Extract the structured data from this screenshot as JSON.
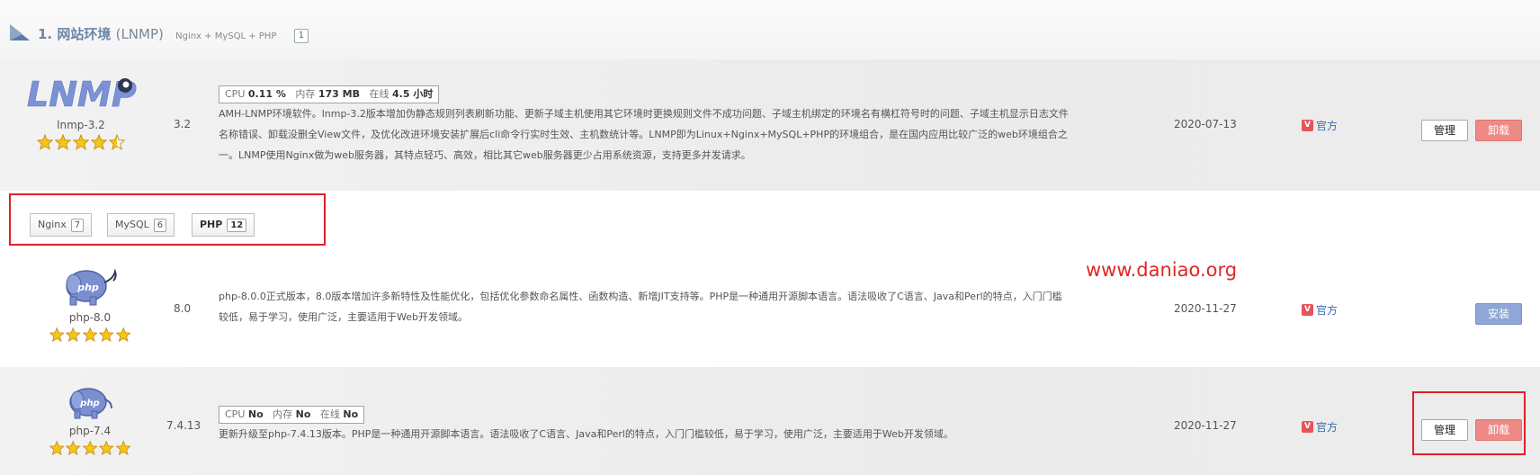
{
  "section": {
    "title": "1. 网站环境",
    "subtitle": "(LNMP)",
    "small": "Nginx + MySQL + PHP",
    "count": "1"
  },
  "lnmp": {
    "logo_text": "LNMP",
    "name": "lnmp-3.2",
    "stars": 4.5,
    "version": "3.2",
    "usage": {
      "cpu_label": "CPU",
      "cpu_value": "0.11 %",
      "mem_label": "内存",
      "mem_value": "173 MB",
      "online_label": "在线",
      "online_value": "4.5 小时"
    },
    "desc_lines": [
      "AMH-LNMP环境软件。lnmp-3.2版本增加伪静态规则列表刷新功能、更新子域主机使用其它环境时更换规则文件不成功问题、子域主机绑定的环境名有横杠符号时的问题、子域主机显示日志文件",
      "名称错误、卸载没删全View文件，及优化改进环境安装扩展后cli命令行实时生效、主机数统计等。LNMP即为Linux+Nginx+MySQL+PHP的环境组合，是在国内应用比较广泛的web环境组合之",
      "一。LNMP使用Nginx做为web服务器，其特点轻巧、高效，相比其它web服务器更少占用系统资源，支持更多并发请求。"
    ],
    "date": "2020-07-13",
    "official": "官方",
    "manage_label": "管理",
    "uninstall_label": "卸载"
  },
  "tabs": [
    {
      "label": "Nginx",
      "count": "7"
    },
    {
      "label": "MySQL",
      "count": "6"
    },
    {
      "label": "PHP",
      "count": "12"
    }
  ],
  "watermark": "www.daniao.org",
  "php80": {
    "name": "php-8.0",
    "stars": 5,
    "version": "8.0",
    "desc_lines": [
      "php-8.0.0正式版本，8.0版本增加许多新特性及性能优化，包括优化参数命名属性、函数构造、新增JIT支持等。PHP是一种通用开源脚本语言。语法吸收了C语言、Java和Perl的特点，入门门槛",
      "较低，易于学习，使用广泛，主要适用于Web开发领域。"
    ],
    "date": "2020-11-27",
    "official": "官方",
    "install_label": "安装"
  },
  "php74": {
    "name": "php-7.4",
    "stars": 5,
    "version": "7.4.13",
    "usage": {
      "cpu_label": "CPU",
      "cpu_value": "No",
      "mem_label": "内存",
      "mem_value": "No",
      "online_label": "在线",
      "online_value": "No"
    },
    "desc_lines": [
      "更新升级至php-7.4.13版本。PHP是一种通用开源脚本语言。语法吸收了C语言、Java和Perl的特点，入门门槛较低，易于学习，使用广泛，主要适用于Web开发领域。"
    ],
    "date": "2020-11-27",
    "official": "官方",
    "manage_label": "管理",
    "uninstall_label": "卸载"
  },
  "colors": {
    "accent": "#6f85a8",
    "uninstall": "#ee8a86",
    "install": "#8fa7d6",
    "highlight": "#e0202a",
    "official": "#3a6aa8",
    "star": "#f5c518"
  }
}
